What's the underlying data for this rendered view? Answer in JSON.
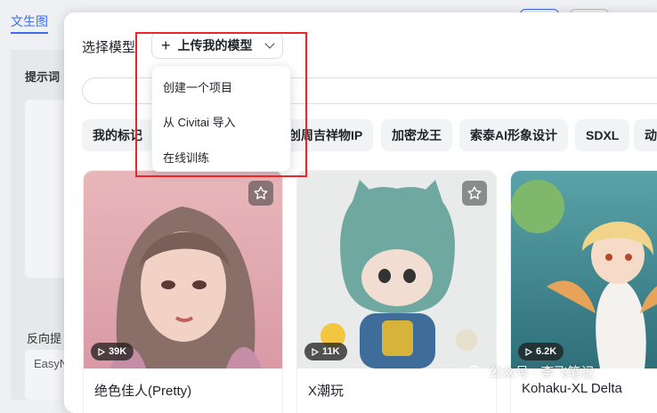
{
  "background": {
    "tab_label": "文生图",
    "prompt_label": "提示词",
    "negative_label": "反向提",
    "negative_value": "EasyN"
  },
  "modal": {
    "title": "选择模型",
    "upload_button": "上传我的模型",
    "search_placeholder": ""
  },
  "dropdown": {
    "items": [
      "创建一个项目",
      "从 Civitai 导入",
      "在线训练"
    ]
  },
  "chips": [
    "我的标记",
    "创周吉祥物IP",
    "加密龙王",
    "索泰AI形象设计",
    "SDXL",
    "动"
  ],
  "cards": [
    {
      "name": "绝色佳人(Pretty)",
      "count": "39K"
    },
    {
      "name": "X潮玩",
      "count": "11K"
    },
    {
      "name": "Kohaku-XL Delta",
      "count": "6.2K"
    }
  ],
  "watermark": "公众号 · 李飞笔记",
  "colors": {
    "accent": "#3a6df0",
    "highlight": "#e8262b"
  }
}
